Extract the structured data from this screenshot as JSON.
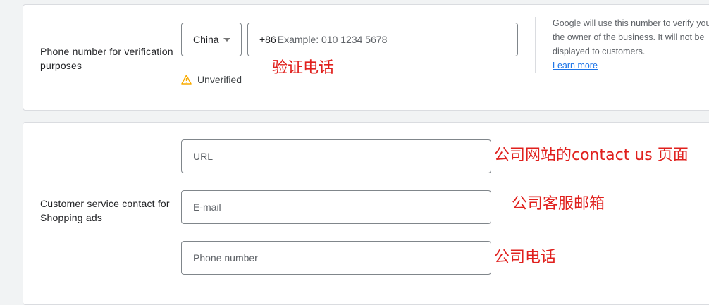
{
  "verification": {
    "label": "Phone number for verification purposes",
    "country_select": "China",
    "dial_prefix": "+86",
    "phone_placeholder": "Example: 010 1234 5678",
    "status": "Unverified",
    "help_text": "Google will use this number to verify you're the owner of the business. It will not be displayed to customers.",
    "learn_more": "Learn more"
  },
  "customer_service": {
    "label": "Customer service contact for Shopping ads",
    "url_placeholder": "URL",
    "email_placeholder": "E-mail",
    "phone_placeholder": "Phone number"
  },
  "annotations": {
    "verify_phone": "验证电话",
    "contact_page": "公司网站的contact us 页面",
    "service_email": "公司客服邮箱",
    "company_phone": "公司电话"
  },
  "colors": {
    "annotation": "#e0201d",
    "link": "#1a73e8",
    "warning": "#f9ab00"
  }
}
